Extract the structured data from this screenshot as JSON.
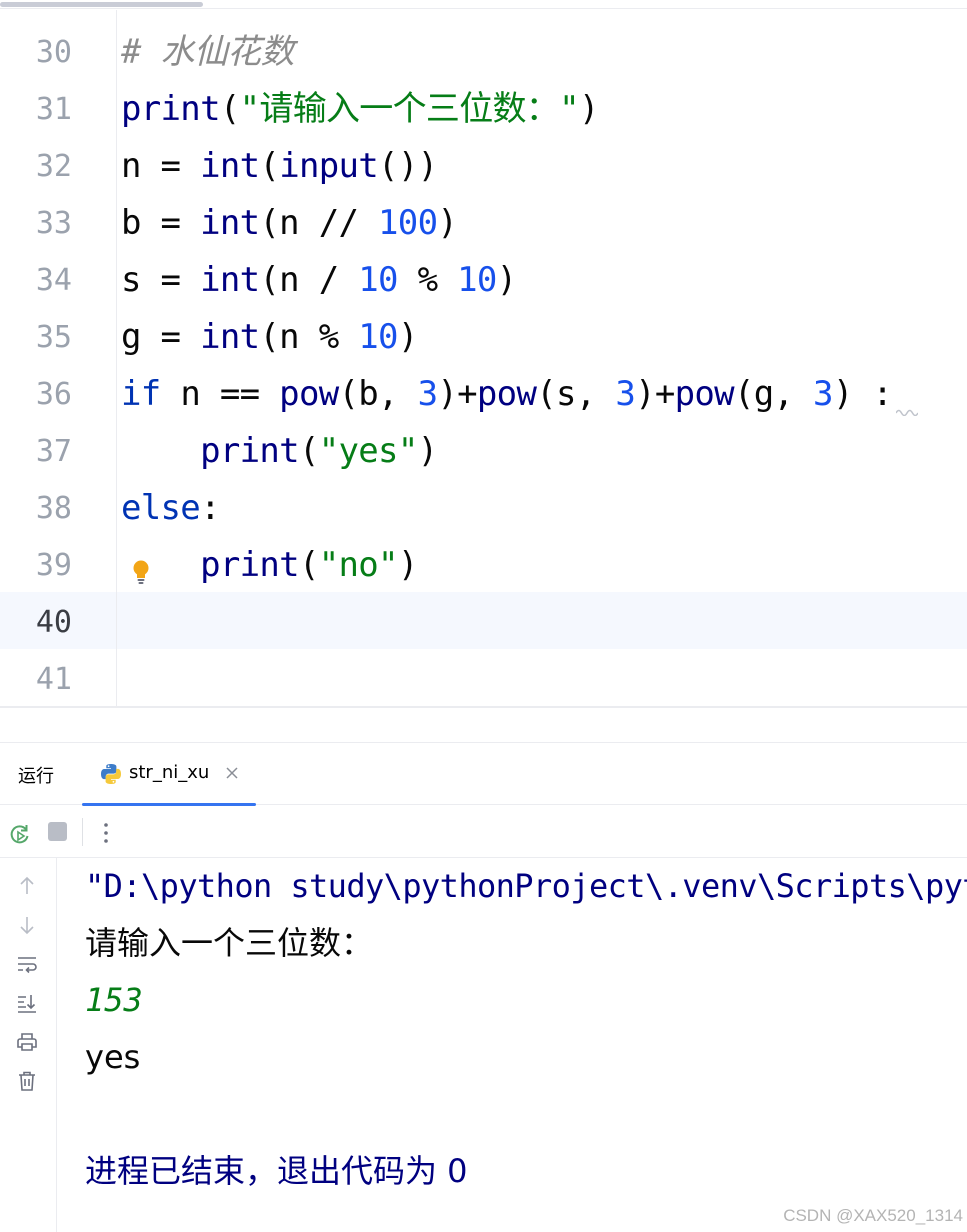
{
  "editor": {
    "lines": [
      {
        "num": "30",
        "tokens": [
          {
            "t": "# 水仙花数",
            "c": "cmt"
          }
        ]
      },
      {
        "num": "31",
        "tokens": [
          {
            "t": "print",
            "c": "fn"
          },
          {
            "t": "(",
            "c": ""
          },
          {
            "t": "\"请输入一个三位数：\"",
            "c": "str"
          },
          {
            "t": ")",
            "c": ""
          }
        ]
      },
      {
        "num": "32",
        "tokens": [
          {
            "t": "n = ",
            "c": ""
          },
          {
            "t": "int",
            "c": "fn"
          },
          {
            "t": "(",
            "c": ""
          },
          {
            "t": "input",
            "c": "fn"
          },
          {
            "t": "())",
            "c": ""
          }
        ]
      },
      {
        "num": "33",
        "tokens": [
          {
            "t": "b = ",
            "c": ""
          },
          {
            "t": "int",
            "c": "fn"
          },
          {
            "t": "(n // ",
            "c": ""
          },
          {
            "t": "100",
            "c": "num"
          },
          {
            "t": ")",
            "c": ""
          }
        ]
      },
      {
        "num": "34",
        "tokens": [
          {
            "t": "s = ",
            "c": ""
          },
          {
            "t": "int",
            "c": "fn"
          },
          {
            "t": "(n / ",
            "c": ""
          },
          {
            "t": "10",
            "c": "num"
          },
          {
            "t": " % ",
            "c": ""
          },
          {
            "t": "10",
            "c": "num"
          },
          {
            "t": ")",
            "c": ""
          }
        ]
      },
      {
        "num": "35",
        "tokens": [
          {
            "t": "g = ",
            "c": ""
          },
          {
            "t": "int",
            "c": "fn"
          },
          {
            "t": "(n % ",
            "c": ""
          },
          {
            "t": "10",
            "c": "num"
          },
          {
            "t": ")",
            "c": ""
          }
        ]
      },
      {
        "num": "36",
        "tokens": [
          {
            "t": "if",
            "c": "kw"
          },
          {
            "t": " n == ",
            "c": ""
          },
          {
            "t": "pow",
            "c": "fn"
          },
          {
            "t": "(b, ",
            "c": ""
          },
          {
            "t": "3",
            "c": "num"
          },
          {
            "t": ")+",
            "c": ""
          },
          {
            "t": "pow",
            "c": "fn"
          },
          {
            "t": "(s, ",
            "c": ""
          },
          {
            "t": "3",
            "c": "num"
          },
          {
            "t": ")+",
            "c": ""
          },
          {
            "t": "pow",
            "c": "fn"
          },
          {
            "t": "(g, ",
            "c": ""
          },
          {
            "t": "3",
            "c": "num"
          },
          {
            "t": ") :",
            "c": ""
          }
        ]
      },
      {
        "num": "37",
        "tokens": [
          {
            "t": "    ",
            "c": ""
          },
          {
            "t": "print",
            "c": "fn"
          },
          {
            "t": "(",
            "c": ""
          },
          {
            "t": "\"yes\"",
            "c": "str"
          },
          {
            "t": ")",
            "c": ""
          }
        ]
      },
      {
        "num": "38",
        "tokens": [
          {
            "t": "else",
            "c": "kw"
          },
          {
            "t": ":",
            "c": ""
          }
        ]
      },
      {
        "num": "39",
        "tokens": [
          {
            "t": "    ",
            "c": ""
          },
          {
            "t": "print",
            "c": "fn"
          },
          {
            "t": "(",
            "c": ""
          },
          {
            "t": "\"no\"",
            "c": "str"
          },
          {
            "t": ")",
            "c": ""
          }
        ]
      },
      {
        "num": "40",
        "tokens": []
      },
      {
        "num": "41",
        "tokens": []
      }
    ],
    "current_line": "40"
  },
  "run_window": {
    "label": "运行",
    "tab": {
      "label": "str_ni_xu",
      "icon": "python-icon"
    },
    "toolbar": {
      "rerun_icon": "rerun-icon",
      "stop_icon": "stop-icon",
      "more_icon": "more-vertical-icon"
    },
    "side_icons": [
      "arrow-up-icon",
      "arrow-down-icon",
      "soft-wrap-icon",
      "scroll-to-end-icon",
      "print-icon",
      "trash-icon"
    ],
    "console": [
      {
        "text": "\"D:\\python study\\pythonProject\\.venv\\Scripts\\python.exe\" \"D:\\python study\\pythonProject\\str_ni_xu.py\"",
        "kind": "cmd"
      },
      {
        "text": "请输入一个三位数：",
        "kind": "out"
      },
      {
        "text": "153",
        "kind": "in"
      },
      {
        "text": "yes",
        "kind": "out"
      },
      {
        "text": "",
        "kind": "out"
      },
      {
        "text": "进程已结束，退出代码为 0",
        "kind": "sys"
      }
    ]
  },
  "watermark": "CSDN @XAX520_1314",
  "colors": {
    "keyword": "#0033b3",
    "builtin": "#000080",
    "string": "#067d17",
    "number": "#1750eb",
    "comment": "#8c8c8c",
    "accent": "#3574f0"
  }
}
